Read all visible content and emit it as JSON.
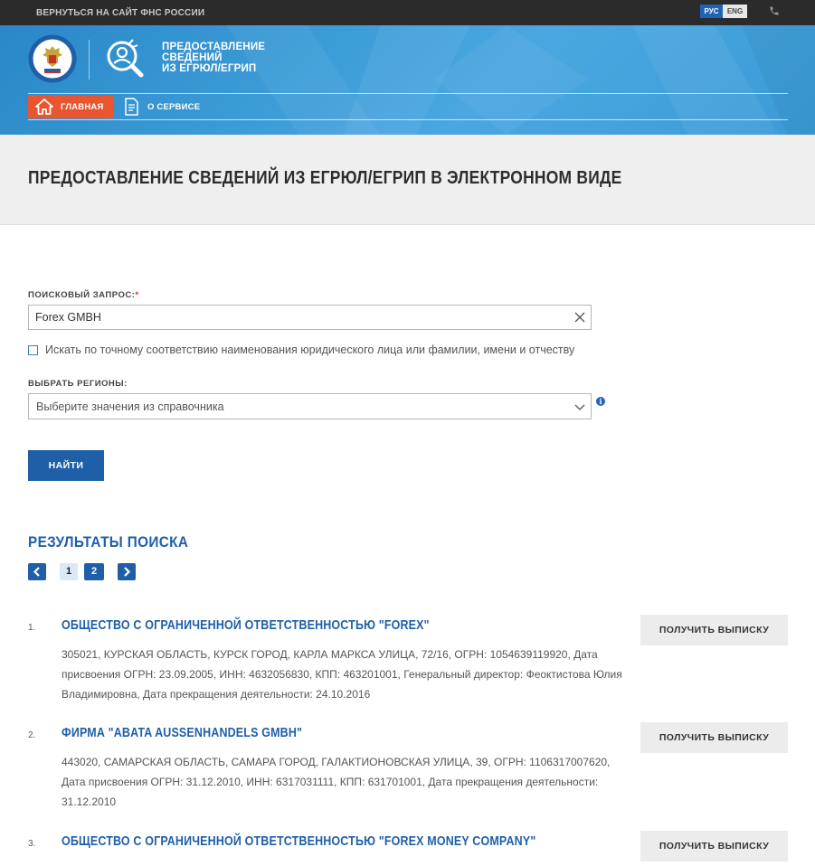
{
  "topbar": {
    "back_link": "ВЕРНУТЬСЯ НА САЙТ ФНС РОССИИ",
    "lang_ru": "РУС",
    "lang_en": "ENG",
    "phone_icon": "phone-icon"
  },
  "header": {
    "title_line1": "ПРЕДОСТАВЛЕНИЕ",
    "title_line2": "СВЕДЕНИЙ",
    "title_line3": "ИЗ ЕГРЮЛ/ЕГРИП",
    "nav": {
      "home": "ГЛАВНАЯ",
      "about": "О СЕРВИСЕ"
    }
  },
  "page": {
    "title": "ПРЕДОСТАВЛЕНИЕ СВЕДЕНИЙ ИЗ ЕГРЮЛ/ЕГРИП В ЭЛЕКТРОННОМ ВИДЕ"
  },
  "form": {
    "query_label": "ПОИСКОВЫЙ ЗАПРОС:",
    "query_required": "*",
    "query_value": "Forex GMBH",
    "exact_match_label": "Искать по точному соответствию наименования юридического лица или фамилии, имени и отчеству",
    "exact_match_checked": false,
    "regions_label": "ВЫБРАТЬ РЕГИОНЫ:",
    "regions_placeholder": "Выберите значения из справочника",
    "info_icon": "i",
    "find_button": "НАЙТИ"
  },
  "results": {
    "title": "РЕЗУЛЬТАТЫ ПОИСКА",
    "pages": [
      "1",
      "2"
    ],
    "current_page": "1",
    "items": [
      {
        "num": "1.",
        "name": "ОБЩЕСТВО С ОГРАНИЧЕННОЙ ОТВЕТСТВЕННОСТЬЮ \"FOREX\"",
        "details": "305021, КУРСКАЯ ОБЛАСТЬ, КУРСК ГОРОД, КАРЛА МАРКСА УЛИЦА, 72/16, ОГРН: 1054639119920, Дата присвоения ОГРН: 23.09.2005, ИНН: 4632056830, КПП: 463201001, Генеральный директор: Феоктистова Юлия Владимировна, Дата прекращения деятельности: 24.10.2016",
        "button": "ПОЛУЧИТЬ ВЫПИСКУ"
      },
      {
        "num": "2.",
        "name": "ФИРМА \"ABATA AUSSENHANDELS GMBH\"",
        "details": "443020, САМАРСКАЯ ОБЛАСТЬ, САМАРА ГОРОД, ГАЛАКТИОНОВСКАЯ УЛИЦА, 39, ОГРН: 1106317007620, Дата присвоения ОГРН: 31.12.2010, ИНН: 6317031111, КПП: 631701001, Дата прекращения деятельности: 31.12.2010",
        "button": "ПОЛУЧИТЬ ВЫПИСКУ"
      },
      {
        "num": "3.",
        "name": "ОБЩЕСТВО С ОГРАНИЧЕННОЙ ОТВЕТСТВЕННОСТЬЮ \"FOREX MONEY COMPANY\"",
        "details": "",
        "button": "ПОЛУЧИТЬ ВЫПИСКУ"
      }
    ]
  },
  "colors": {
    "accent": "#1e5fa8",
    "header_blue": "#3b9bd6",
    "nav_active": "#e8552e",
    "topbar": "#2b2b2b"
  }
}
